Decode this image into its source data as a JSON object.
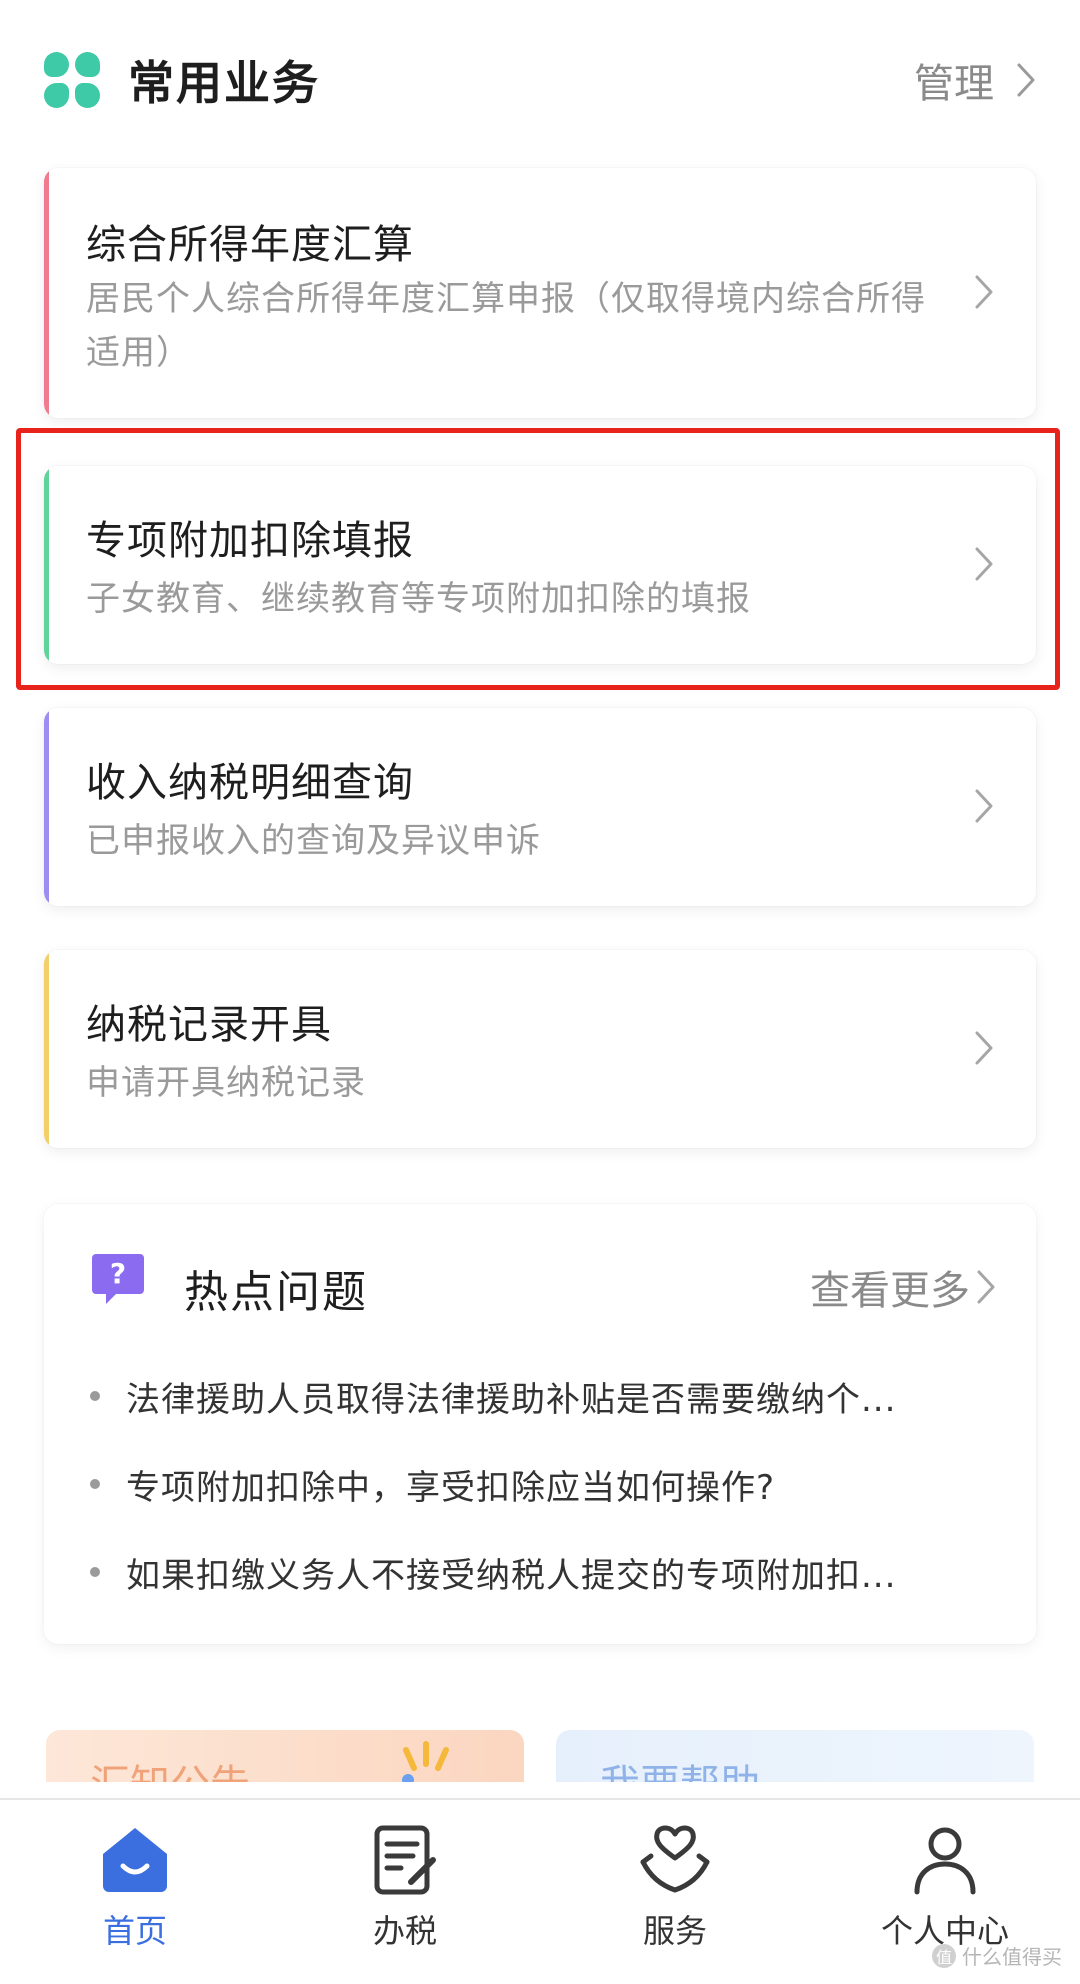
{
  "header": {
    "title": "常用业务",
    "manage_label": "管理",
    "icon": "clover-icon",
    "accent": "#3ec9a7"
  },
  "services": [
    {
      "title": "综合所得年度汇算",
      "desc": "居民个人综合所得年度汇算申报（仅取得境内综合所得适用）",
      "stripe_color": "#f07b8e"
    },
    {
      "title": "专项附加扣除填报",
      "desc": "子女教育、继续教育等专项附加扣除的填报",
      "stripe_color": "#5fd39a",
      "highlighted": true,
      "highlight_color": "#e8231c"
    },
    {
      "title": "收入纳税明细查询",
      "desc": "已申报收入的查询及异议申诉",
      "stripe_color": "#9b8ef0"
    },
    {
      "title": "纳税记录开具",
      "desc": "申请开具纳税记录",
      "stripe_color": "#f3cf6a"
    }
  ],
  "hot_questions": {
    "title": "热点问题",
    "more_label": "查看更多",
    "icon": "question-bubble-icon",
    "icon_color": "#8b6cf0",
    "items": [
      "法律援助人员取得法律援助补贴是否需要缴纳个...",
      "专项附加扣除中，享受扣除应当如何操作?",
      "如果扣缴义务人不接受纳税人提交的专项附加扣..."
    ]
  },
  "promos": [
    {
      "label": "汇知公告"
    },
    {
      "label": "我要帮助"
    }
  ],
  "tabbar": {
    "active_color": "#3b6fe0",
    "items": [
      {
        "label": "首页",
        "icon": "home-icon",
        "active": true
      },
      {
        "label": "办税",
        "icon": "tax-form-icon",
        "active": false
      },
      {
        "label": "服务",
        "icon": "heart-hands-icon",
        "active": false
      },
      {
        "label": "个人中心",
        "icon": "person-icon",
        "active": false
      }
    ]
  },
  "watermark": "什么值得买"
}
